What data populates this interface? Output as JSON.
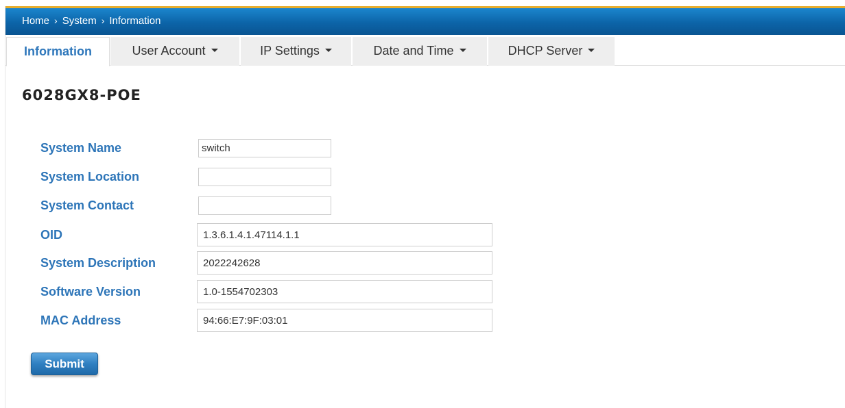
{
  "breadcrumb": {
    "items": [
      "Home",
      "System",
      "Information"
    ],
    "separator": "›"
  },
  "tabs": [
    {
      "label": "Information",
      "active": true,
      "dropdown": false
    },
    {
      "label": "User Account",
      "active": false,
      "dropdown": true
    },
    {
      "label": "IP Settings",
      "active": false,
      "dropdown": true
    },
    {
      "label": "Date and Time",
      "active": false,
      "dropdown": true
    },
    {
      "label": "DHCP Server",
      "active": false,
      "dropdown": true
    }
  ],
  "page_title": "6028GX8-POE",
  "form": {
    "system_name": {
      "label": "System Name",
      "value": "switch"
    },
    "system_location": {
      "label": "System Location",
      "value": ""
    },
    "system_contact": {
      "label": "System Contact",
      "value": ""
    },
    "oid": {
      "label": "OID",
      "value": "1.3.6.1.4.1.47114.1.1"
    },
    "system_description": {
      "label": "System Description",
      "value": "2022242628"
    },
    "software_version": {
      "label": "Software Version",
      "value": "1.0-1554702303"
    },
    "mac_address": {
      "label": "MAC Address",
      "value": "94:66:E7:9F:03:01"
    }
  },
  "submit_label": "Submit",
  "colors": {
    "header_blue": "#0c64a8",
    "header_accent": "#e7ad2c",
    "label_blue": "#2d75b8",
    "button_blue": "#2f7fc1"
  },
  "icons": {
    "breadcrumb_separator": "chevron-right-icon",
    "tab_dropdown": "caret-down-icon"
  }
}
